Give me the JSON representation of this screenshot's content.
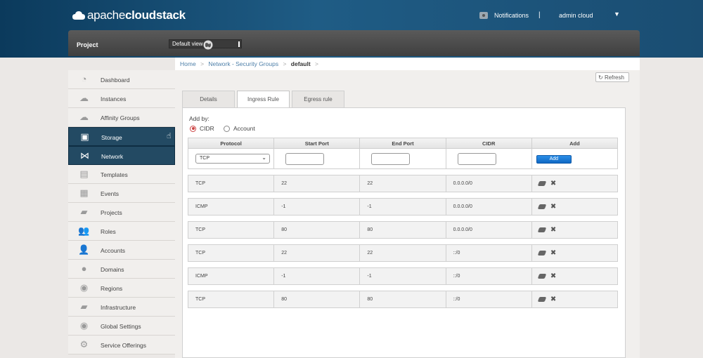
{
  "header": {
    "logo_light": "apache",
    "logo_bold": "cloudstack",
    "notifications_label": "Notifications",
    "separator": "|",
    "user_label": "admin cloud",
    "user_caret": "▼"
  },
  "project_bar": {
    "label": "Project",
    "selected": "Default view"
  },
  "sidebar": {
    "items": [
      {
        "label": "Dashboard",
        "icon": "dashboard-icon",
        "glyph": "◔"
      },
      {
        "label": "Instances",
        "icon": "cloud-icon",
        "glyph": "☁"
      },
      {
        "label": "Affinity Groups",
        "icon": "affinity-icon",
        "glyph": "☁"
      },
      {
        "label": "Storage",
        "icon": "storage-icon",
        "glyph": "▣"
      },
      {
        "label": "Network",
        "icon": "network-icon",
        "glyph": "⋈"
      },
      {
        "label": "Templates",
        "icon": "templates-icon",
        "glyph": "▤"
      },
      {
        "label": "Events",
        "icon": "events-icon",
        "glyph": "▦"
      },
      {
        "label": "Projects",
        "icon": "folder-icon",
        "glyph": "▰"
      },
      {
        "label": "Roles",
        "icon": "roles-icon",
        "glyph": "👥"
      },
      {
        "label": "Accounts",
        "icon": "account-icon",
        "glyph": "👤"
      },
      {
        "label": "Domains",
        "icon": "domains-icon",
        "glyph": "●"
      },
      {
        "label": "Regions",
        "icon": "globe-icon",
        "glyph": "◉"
      },
      {
        "label": "Infrastructure",
        "icon": "infrastructure-icon",
        "glyph": "▰"
      },
      {
        "label": "Global Settings",
        "icon": "globe-settings-icon",
        "glyph": "◉"
      },
      {
        "label": "Service Offerings",
        "icon": "gear-icon",
        "glyph": "⚙"
      }
    ],
    "active": [
      "Storage",
      "Network"
    ]
  },
  "breadcrumb": {
    "home": "Home",
    "section": "Network - Security Groups",
    "current": "default",
    "arrow": ">"
  },
  "toolbar": {
    "refresh_label": "Refresh"
  },
  "tabs": [
    {
      "label": "Details"
    },
    {
      "label": "Ingress Rule",
      "active": true
    },
    {
      "label": "Egress rule"
    }
  ],
  "form": {
    "add_by_label": "Add by:",
    "options": [
      "CIDR",
      "Account"
    ],
    "selected_option": "CIDR",
    "columns": [
      "Protocol",
      "Start Port",
      "End Port",
      "CIDR",
      "Add"
    ],
    "protocol_value": "TCP",
    "add_button_label": "Add"
  },
  "rules": [
    {
      "protocol": "TCP",
      "start_port": "22",
      "end_port": "22",
      "cidr": "0.0.0.0/0"
    },
    {
      "protocol": "ICMP",
      "start_port": "-1",
      "end_port": "-1",
      "cidr": "0.0.0.0/0"
    },
    {
      "protocol": "TCP",
      "start_port": "80",
      "end_port": "80",
      "cidr": "0.0.0.0/0"
    },
    {
      "protocol": "TCP",
      "start_port": "22",
      "end_port": "22",
      "cidr": "::/0"
    },
    {
      "protocol": "ICMP",
      "start_port": "-1",
      "end_port": "-1",
      "cidr": "::/0"
    },
    {
      "protocol": "TCP",
      "start_port": "80",
      "end_port": "80",
      "cidr": "::/0"
    }
  ]
}
